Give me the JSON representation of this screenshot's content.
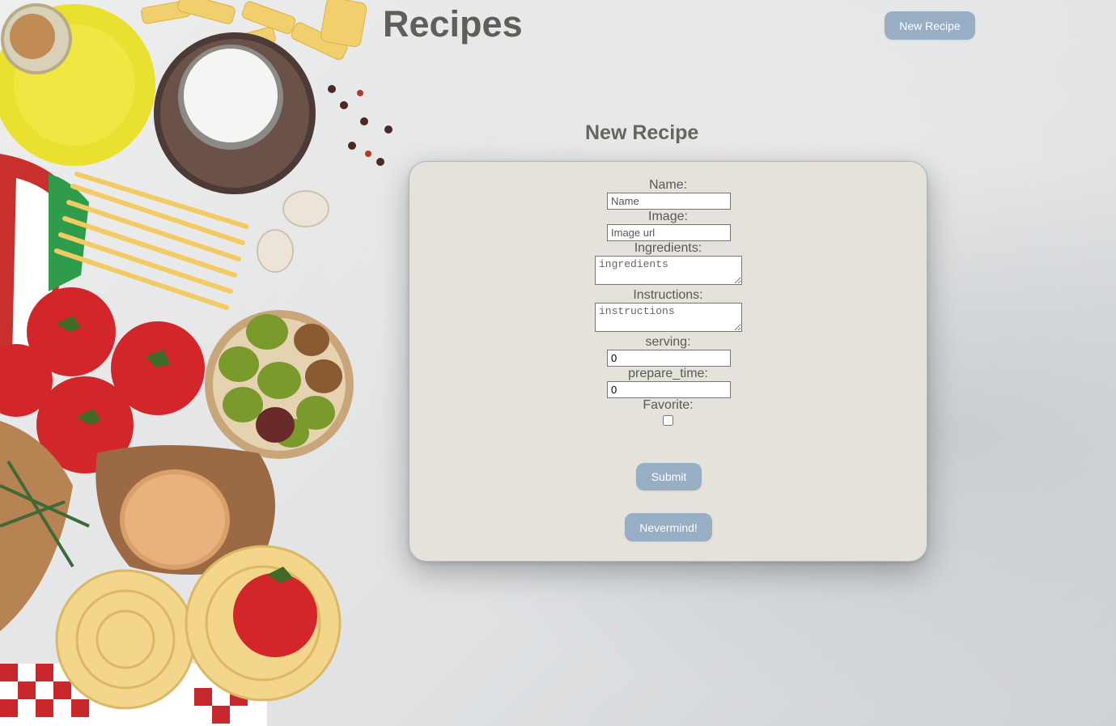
{
  "header": {
    "title": "Recipes",
    "new_recipe_button": "New Recipe"
  },
  "form": {
    "heading": "New Recipe",
    "fields": {
      "name": {
        "label": "Name:",
        "placeholder": "Name",
        "value": ""
      },
      "image": {
        "label": "Image:",
        "placeholder": "Image url",
        "value": ""
      },
      "ingredients": {
        "label": "Ingredients:",
        "placeholder": "ingredients",
        "value": ""
      },
      "instructions": {
        "label": "Instructions:",
        "placeholder": "instructions",
        "value": ""
      },
      "serving": {
        "label": "serving:",
        "value": "0"
      },
      "prepare_time": {
        "label": "prepare_time:",
        "value": "0"
      },
      "favorite": {
        "label": "Favorite:",
        "checked": false
      }
    },
    "submit_label": "Submit",
    "cancel_label": "Nevermind!"
  },
  "colors": {
    "button_bg": "#97aec4",
    "button_text": "#ffffff",
    "card_bg": "#e5e2dc",
    "title_text": "#5f5f5a"
  }
}
